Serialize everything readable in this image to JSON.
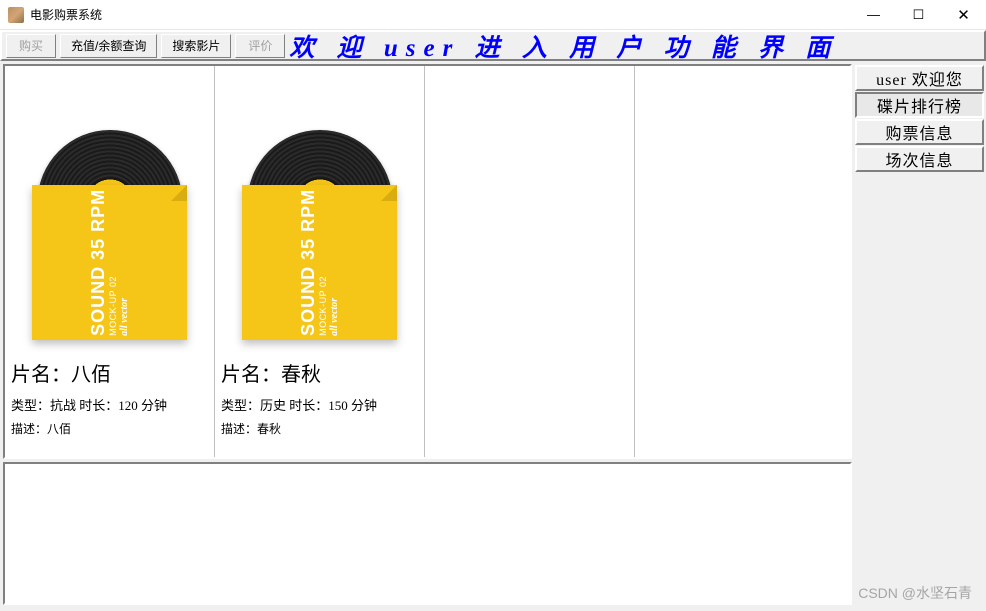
{
  "window": {
    "title": "电影购票系统",
    "controls": {
      "min": "—",
      "max": "☐",
      "close": "✕"
    }
  },
  "toolbar": {
    "buy": "购买",
    "recharge": "充值/余额查询",
    "search": "搜索影片",
    "review": "评价"
  },
  "welcome_text": "欢 迎 user 进 入 用 户 功 能 界 面",
  "sidebar": {
    "welcome": "user 欢迎您",
    "ranking": "碟片排行榜",
    "ticket_info": "购票信息",
    "session_info": "场次信息"
  },
  "movies": [
    {
      "title_line": "片名：八佰",
      "meta_line": "类型：抗战  时长：120 分钟",
      "desc_line": "描述：八佰",
      "cover": {
        "line1": "SOUND 35 RPM",
        "line2": "MOCK-UP 02",
        "line3": "all vector"
      }
    },
    {
      "title_line": "片名：春秋",
      "meta_line": "类型：历史  时长：150 分钟",
      "desc_line": "描述：春秋",
      "cover": {
        "line1": "SOUND 35 RPM",
        "line2": "MOCK-UP 02",
        "line3": "all vector"
      }
    }
  ],
  "watermark": "CSDN @水坚石青"
}
